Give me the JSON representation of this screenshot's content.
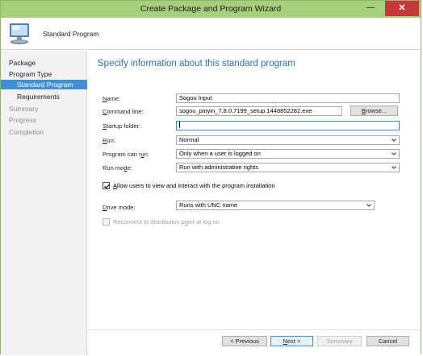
{
  "window": {
    "title": "Create Package and Program Wizard",
    "minimize_glyph": "—",
    "close_glyph": "✕"
  },
  "header": {
    "title": "Standard Program",
    "icon": "computer-icon"
  },
  "sidebar": {
    "items": [
      {
        "label": "Package",
        "state": "normal"
      },
      {
        "label": "Program Type",
        "state": "normal"
      },
      {
        "label": "Standard Program",
        "state": "active"
      },
      {
        "label": "Requirements",
        "state": "normal"
      },
      {
        "label": "Summary",
        "state": "disabled"
      },
      {
        "label": "Progress",
        "state": "disabled"
      },
      {
        "label": "Completion",
        "state": "disabled"
      }
    ]
  },
  "main": {
    "heading": "Specify information about this standard program",
    "fields": {
      "name": {
        "label_pre": "",
        "label_u": "N",
        "label_post": "ame:",
        "value": "Sogou Input"
      },
      "command_line": {
        "label_pre": "",
        "label_u": "C",
        "label_post": "ommand line:",
        "value": "sogou_pinyin_7.8.0.7199_setup.1448852282.exe"
      },
      "browse_button": {
        "label_pre": "",
        "label_u": "B",
        "label_post": "rowse..."
      },
      "startup_folder": {
        "label_pre": "",
        "label_u": "S",
        "label_post": "tartup folder:",
        "value": ""
      },
      "run": {
        "label_pre": "",
        "label_u": "R",
        "label_post": "un:",
        "value": "Normal"
      },
      "program_can_run": {
        "label_pre": "Program can r",
        "label_u": "u",
        "label_post": "n:",
        "value": "Only when a user is logged on"
      },
      "run_mode": {
        "label_pre": "Run mo",
        "label_u": "d",
        "label_post": "e:",
        "value": "Run with administrative rights"
      },
      "allow_interact": {
        "label_pre": "",
        "label_u": "A",
        "label_post": "llow users to view and interact with the program installation",
        "checked": true
      },
      "drive_mode": {
        "label_pre": "",
        "label_u": "D",
        "label_post": "rive mode:",
        "value": "Runs with UNC name"
      },
      "reconnect": {
        "label_pre": "Reconnect to distribution p",
        "label_u": "o",
        "label_post": "int at log on",
        "checked": false,
        "enabled": false
      }
    }
  },
  "footer": {
    "previous": "< Previous",
    "next_u": "N",
    "next_post": "ext >",
    "summary": "Summary",
    "cancel": "Cancel"
  },
  "colors": {
    "titlebar": "#a6cf7b",
    "close": "#c7383b",
    "accent": "#3e8fd6",
    "heading": "#2e6fb0"
  }
}
